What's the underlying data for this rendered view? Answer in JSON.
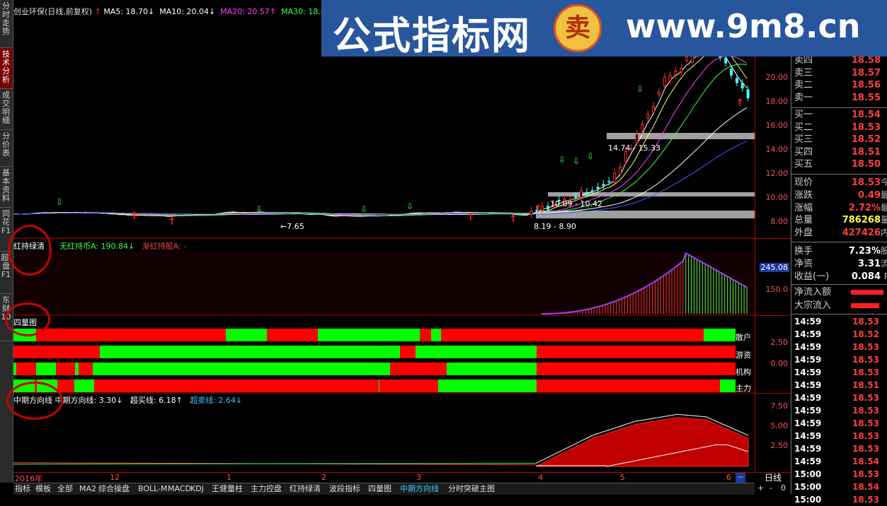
{
  "left_tabs": [
    {
      "label": "分时走势",
      "active": false
    },
    {
      "label": "技术分析",
      "active": true
    },
    {
      "label": "成交明细",
      "active": false
    },
    {
      "label": "分价表",
      "active": false
    },
    {
      "label": "基本资料",
      "active": false
    },
    {
      "label": "同花F1",
      "active": false
    },
    {
      "label": "超I盘F1",
      "active": false
    },
    {
      "label": "东财10",
      "active": false
    }
  ],
  "main_legend": {
    "stock": "创业环保(日线,前复权)",
    "ma5": "MA5: 18.70↓",
    "ma10": "MA10: 20.04↓",
    "ma20": "MA20: 20.57↑",
    "ma30": "MA30: 18.6"
  },
  "price_axis": [
    "20.00",
    "18.00",
    "16.00",
    "14.00",
    "12.00",
    "10.00",
    "8.00"
  ],
  "annotations": {
    "low": "←7.65",
    "range1": "8.19 - 8.90",
    "range2": "10.09 - 10.42",
    "range3": "14.74 - 15.33"
  },
  "ind1": {
    "title": "红持绿清",
    "a": "无红持币A: 190.84↓",
    "b": "渐红持股A: -",
    "axis_top": "245.08",
    "axis_mid": "150.0"
  },
  "ind2": {
    "title": "四量图",
    "labels": [
      "散户",
      "游资",
      "机构",
      "主力"
    ],
    "axis": [
      "2.50",
      "0.00"
    ]
  },
  "ind3": {
    "title": "中期方向线",
    "a": "中期方向线: 3.30↓",
    "b": "超买线: 6.18↑",
    "c": "超卖线: 2.64↓",
    "axis": [
      "7.50",
      "5.00",
      "2.50"
    ]
  },
  "dates": [
    "2016年",
    "12",
    "1",
    "2",
    "3",
    "4",
    "5",
    "6"
  ],
  "period": "日线",
  "bottom_tabs": [
    "指标",
    "模板",
    "全部",
    "MA2",
    "综合操盘",
    "BOLL-M",
    "MACD",
    "KDJ",
    "王健量柱",
    "主力控盘",
    "红持绿清",
    "波段指标",
    "四量图",
    "中期方向线",
    "分时突破主图"
  ],
  "bottom_active": "中期方向线",
  "controls": [
    "+",
    "-",
    "0"
  ],
  "quote": {
    "sell": [
      {
        "k": "卖四",
        "v": "18.58"
      },
      {
        "k": "卖三",
        "v": "18.57"
      },
      {
        "k": "卖二",
        "v": "18.56"
      },
      {
        "k": "卖一",
        "v": "18.55"
      }
    ],
    "buy": [
      {
        "k": "买一",
        "v": "18.54"
      },
      {
        "k": "买二",
        "v": "18.53"
      },
      {
        "k": "买三",
        "v": "18.52"
      },
      {
        "k": "买四",
        "v": "18.51"
      },
      {
        "k": "买五",
        "v": "18.50"
      }
    ],
    "stats": [
      {
        "k": "现价",
        "v": "18.53",
        "x": "今"
      },
      {
        "k": "涨跌",
        "v": "0.49",
        "x": "最"
      },
      {
        "k": "涨幅",
        "v": "2.72%",
        "x": "最"
      },
      {
        "k": "总量",
        "v": "786268",
        "x": "量"
      },
      {
        "k": "外盘",
        "v": "427426",
        "x": "内"
      }
    ],
    "stats2": [
      {
        "k": "换手",
        "v": "7.23%",
        "x": "股"
      },
      {
        "k": "净资",
        "v": "3.31",
        "x": "流"
      },
      {
        "k": "收益(一)",
        "v": "0.084",
        "x": "P"
      }
    ],
    "flows": [
      {
        "k": "净流入额"
      },
      {
        "k": "大宗流入"
      }
    ]
  },
  "ticks": [
    {
      "t": "14:59",
      "p": "18.53"
    },
    {
      "t": "14:59",
      "p": "18.52"
    },
    {
      "t": "14:59",
      "p": "18.53"
    },
    {
      "t": "14:59",
      "p": "18.53"
    },
    {
      "t": "14:59",
      "p": "18.53"
    },
    {
      "t": "14:59",
      "p": "18.51"
    },
    {
      "t": "14:59",
      "p": "18.53"
    },
    {
      "t": "14:59",
      "p": "18.53"
    },
    {
      "t": "14:59",
      "p": "18.53"
    },
    {
      "t": "14:59",
      "p": "18.53"
    },
    {
      "t": "14:59",
      "p": "18.53"
    },
    {
      "t": "14:59",
      "p": "18.54"
    },
    {
      "t": "15:00",
      "p": "18.53"
    },
    {
      "t": "15:00",
      "p": "18.54"
    },
    {
      "t": "15:00",
      "p": "18.53"
    }
  ],
  "banner": {
    "cn": "公式指标网",
    "logo_char": "卖",
    "url": "www.9m8.cn"
  },
  "colors": {
    "up": "#ff3030",
    "down": "#40ffff",
    "green": "#00ff00",
    "red": "#ff0000",
    "banner": "#27569c"
  }
}
